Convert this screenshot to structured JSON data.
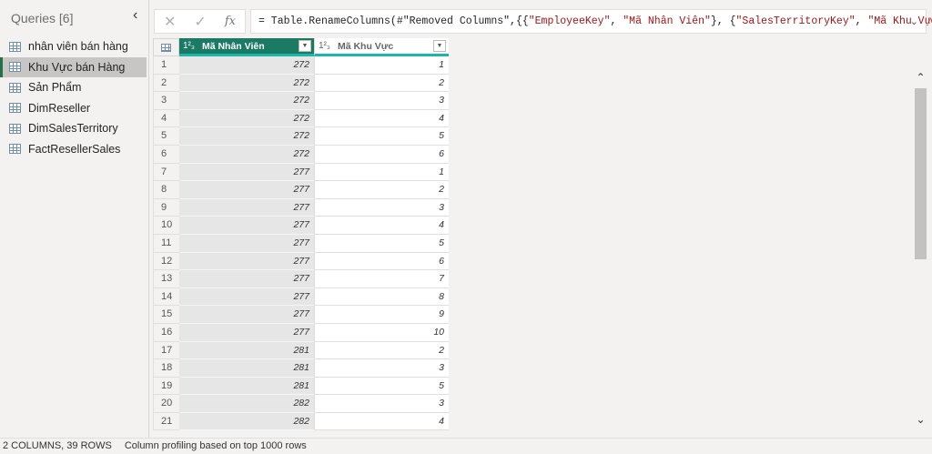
{
  "queries": {
    "title": "Queries [6]",
    "items": [
      {
        "label": "nhân viên bán hàng"
      },
      {
        "label": "Khu Vực bán Hàng",
        "selected": true
      },
      {
        "label": "Sản Phẩm"
      },
      {
        "label": "DimReseller"
      },
      {
        "label": "DimSalesTerritory"
      },
      {
        "label": "FactResellerSales"
      }
    ]
  },
  "formula_bar": {
    "cancel": "✕",
    "commit": "✓",
    "fx": "fx",
    "prefix": "= Table.RenameColumns(#\"Removed Columns\",{{",
    "s1": "\"EmployeeKey\"",
    "sep1": ", ",
    "s2": "\"Mã Nhân Viên\"",
    "sep2": "}, {",
    "s3": "\"SalesTerritoryKey\"",
    "sep3": ", ",
    "s4": "\"Mã Khu Vực\"",
    "suffix": "}})"
  },
  "table": {
    "columns": [
      {
        "type": "1²₃",
        "name": "Mã Nhân Viên"
      },
      {
        "type": "1²₃",
        "name": "Mã Khu Vực"
      }
    ],
    "rows": [
      [
        272,
        1
      ],
      [
        272,
        2
      ],
      [
        272,
        3
      ],
      [
        272,
        4
      ],
      [
        272,
        5
      ],
      [
        272,
        6
      ],
      [
        277,
        1
      ],
      [
        277,
        2
      ],
      [
        277,
        3
      ],
      [
        277,
        4
      ],
      [
        277,
        5
      ],
      [
        277,
        6
      ],
      [
        277,
        7
      ],
      [
        277,
        8
      ],
      [
        277,
        9
      ],
      [
        277,
        10
      ],
      [
        281,
        2
      ],
      [
        281,
        3
      ],
      [
        281,
        5
      ],
      [
        282,
        3
      ],
      [
        282,
        4
      ]
    ]
  },
  "status": {
    "count": "2 COLUMNS, 39 ROWS",
    "profiling": "Column profiling based on top 1000 rows"
  },
  "colors": {
    "accent": "#1a7a64",
    "teal": "#1bb5a9"
  }
}
